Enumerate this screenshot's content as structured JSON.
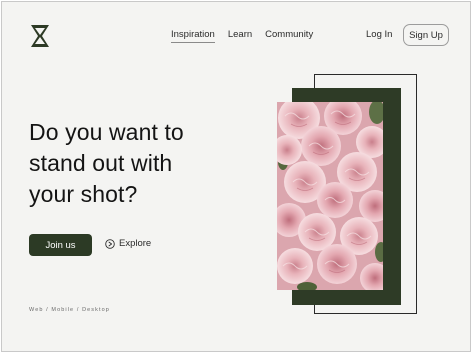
{
  "nav": {
    "items": [
      {
        "label": "Inspiration",
        "active": true
      },
      {
        "label": "Learn",
        "active": false
      },
      {
        "label": "Community",
        "active": false
      }
    ]
  },
  "auth": {
    "login_label": "Log In",
    "signup_label": "Sign Up"
  },
  "hero": {
    "headline_line1": "Do you want to",
    "headline_line2": "stand out with",
    "headline_line3": "your shot?",
    "primary_cta": "Join us",
    "secondary_cta": "Explore",
    "platforms": "Web / Mobile / Desktop"
  },
  "icons": {
    "logo": "x-star-logo-icon",
    "explore": "play-circle-icon"
  },
  "colors": {
    "background": "#f4f4f2",
    "accent_green": "#2c3a25",
    "text": "#141414",
    "flower_pink": "#eab9bf"
  }
}
